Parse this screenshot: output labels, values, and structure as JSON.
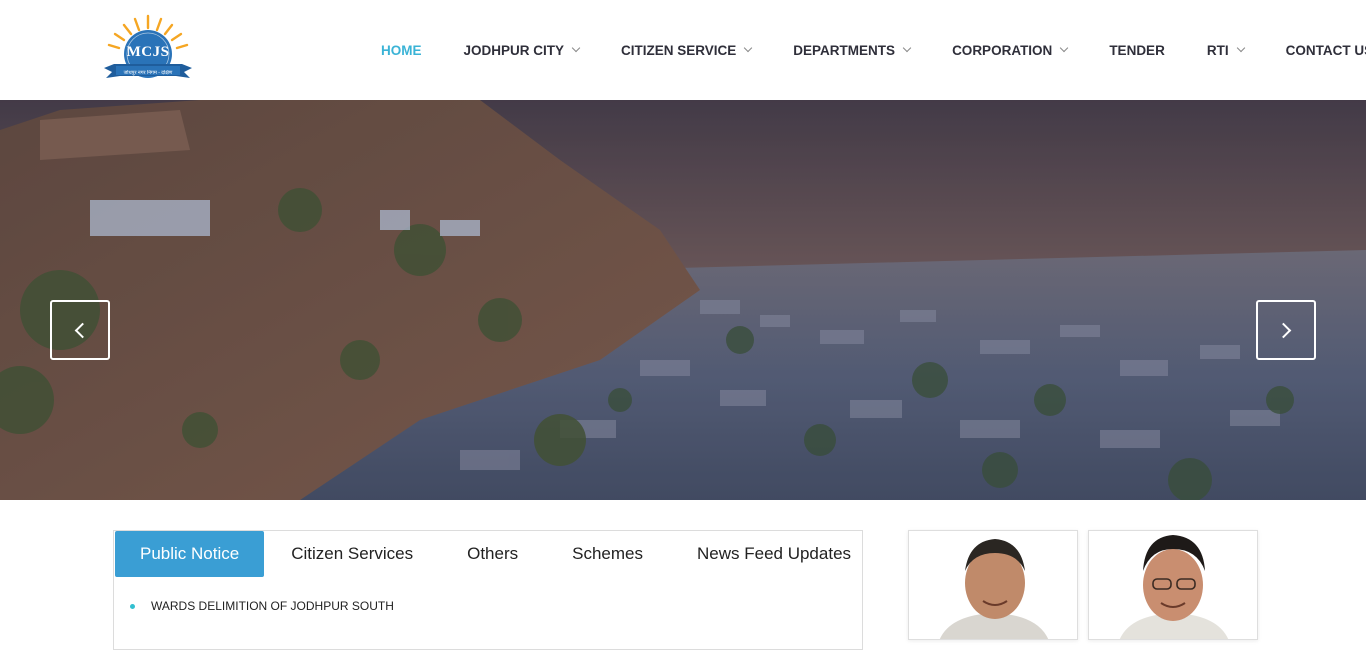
{
  "logo": {
    "text": "MCJS",
    "subtitle": "जोधपुर नगर निगम - दक्षिण",
    "colors": {
      "sun": "#f5a623",
      "ribbon": "#1f5d9c"
    }
  },
  "nav": {
    "items": [
      {
        "label": "HOME",
        "active": true,
        "has_dropdown": false
      },
      {
        "label": "JODHPUR CITY",
        "active": false,
        "has_dropdown": true
      },
      {
        "label": "CITIZEN SERVICE",
        "active": false,
        "has_dropdown": true
      },
      {
        "label": "DEPARTMENTS",
        "active": false,
        "has_dropdown": true
      },
      {
        "label": "CORPORATION",
        "active": false,
        "has_dropdown": true
      },
      {
        "label": "TENDER",
        "active": false,
        "has_dropdown": false
      },
      {
        "label": "RTI",
        "active": false,
        "has_dropdown": true
      },
      {
        "label": "CONTACT US",
        "active": false,
        "has_dropdown": false
      }
    ],
    "active_color": "#3ab3d6"
  },
  "hero": {
    "prev_icon": "chevron-left-icon",
    "next_icon": "chevron-right-icon"
  },
  "tabs": {
    "items": [
      "Public Notice",
      "Citizen Services",
      "Others",
      "Schemes",
      "News Feed Updates"
    ],
    "active_index": 0,
    "active_color": "#3a9ed4"
  },
  "notices": [
    "WARDS DELIMITION OF JODHPUR SOUTH"
  ]
}
